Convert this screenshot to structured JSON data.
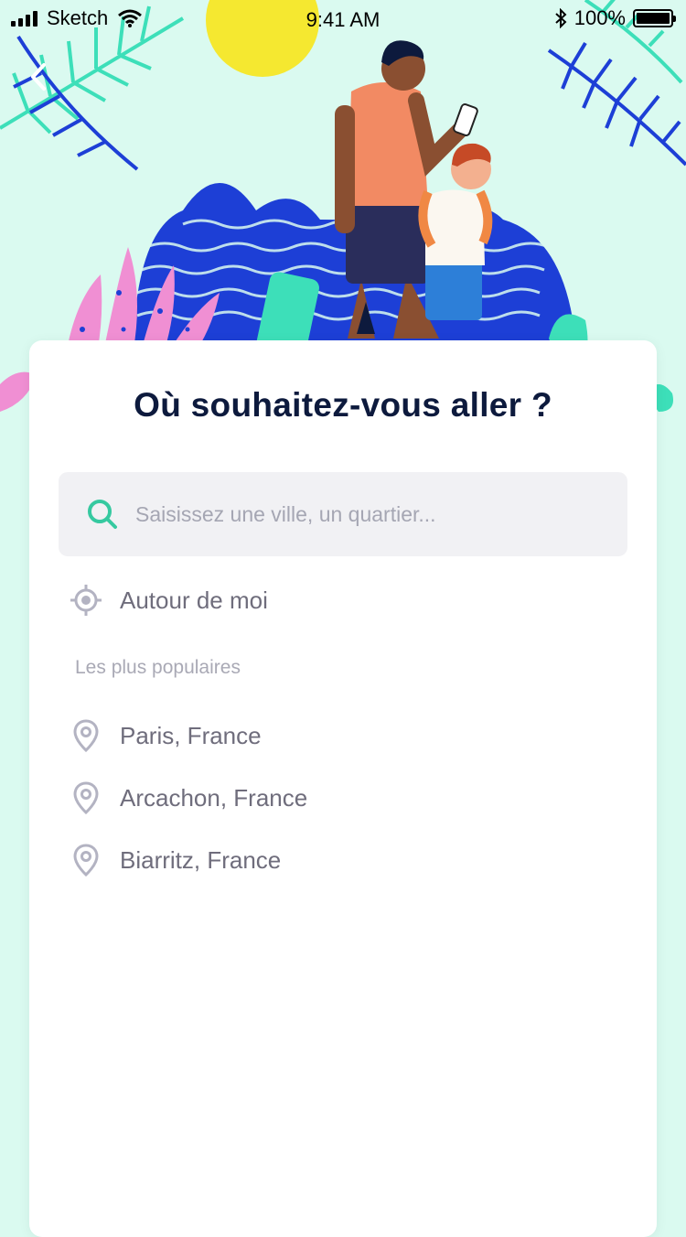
{
  "theme": {
    "background": "#dafaf0",
    "accent": "#36c9a0",
    "title_color": "#0d1a3d",
    "text_color": "#6f6d7c"
  },
  "status_bar": {
    "carrier": "Sketch",
    "time": "9:41 AM",
    "battery": "100%",
    "battery_level": 1.0
  },
  "nav": {
    "back_icon": "chevron-left-icon"
  },
  "hero": {
    "illustration": "travelers-walking-illustration"
  },
  "card": {
    "title": "Où souhaitez-vous aller ?",
    "search": {
      "placeholder": "Saisissez une ville, un quartier...",
      "value": "",
      "icon": "search-icon"
    },
    "nearby": {
      "label": "Autour de moi",
      "icon": "location-target-icon"
    },
    "popular": {
      "heading": "Les plus populaires",
      "items": [
        {
          "label": "Paris, France",
          "icon": "map-pin-icon"
        },
        {
          "label": "Arcachon, France",
          "icon": "map-pin-icon"
        },
        {
          "label": "Biarritz, France",
          "icon": "map-pin-icon"
        }
      ]
    }
  }
}
